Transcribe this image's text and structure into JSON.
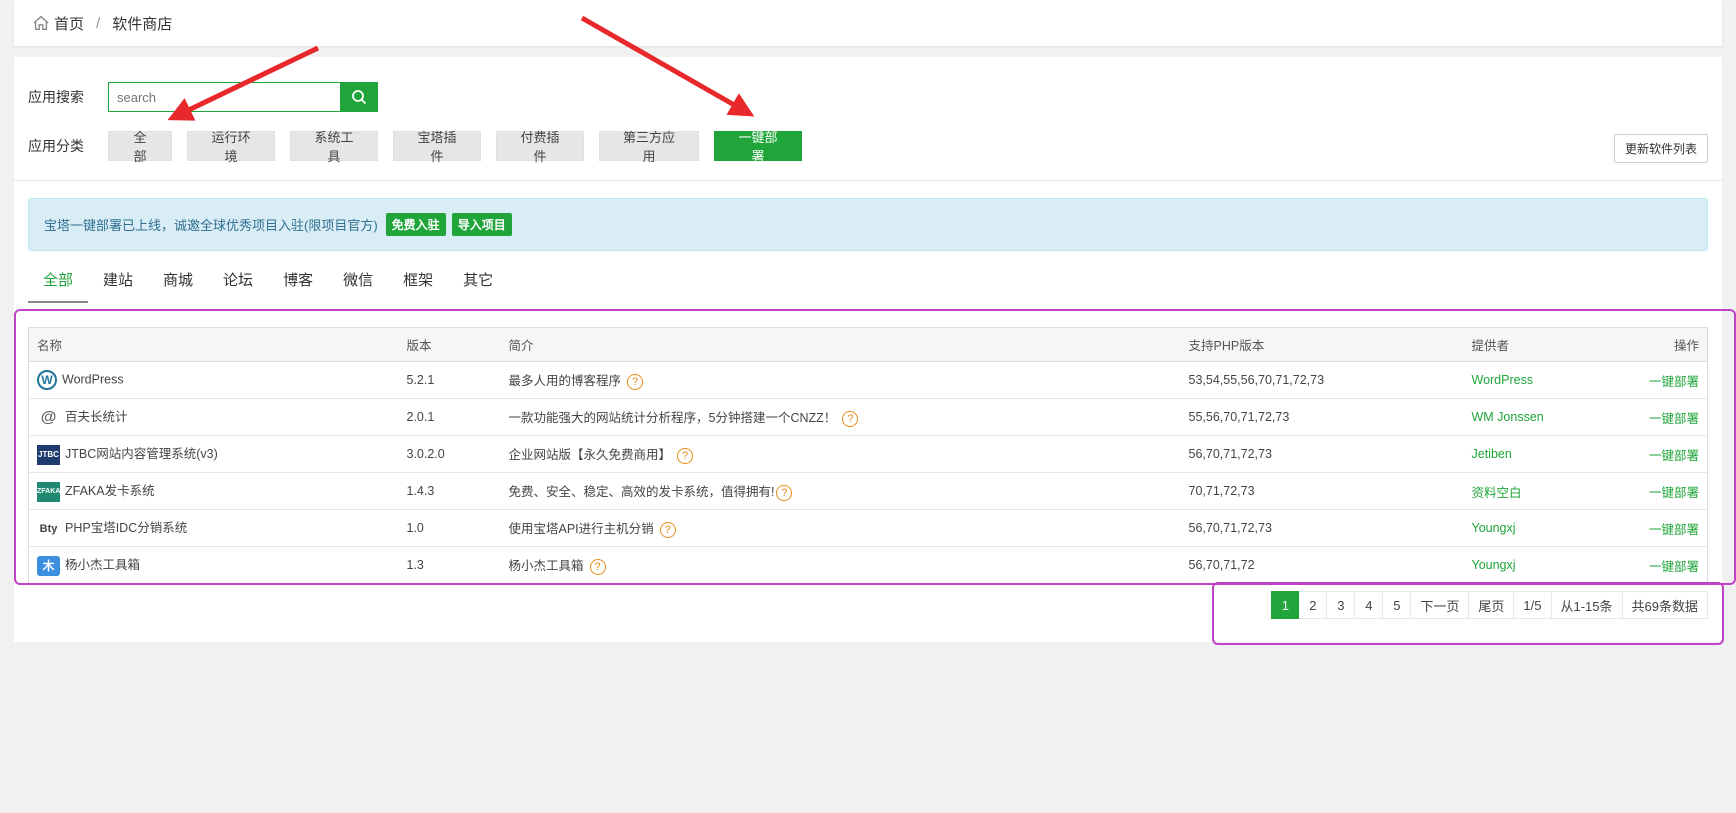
{
  "breadcrumb": {
    "home": "首页",
    "separator": "/",
    "current": "软件商店"
  },
  "search": {
    "label": "应用搜索",
    "placeholder": "search"
  },
  "category": {
    "label": "应用分类",
    "buttons": [
      "全部",
      "运行环境",
      "系统工具",
      "宝塔插件",
      "付费插件",
      "第三方应用",
      "一键部署"
    ],
    "active_index": 6
  },
  "refresh_button": "更新软件列表",
  "notice": {
    "text": "宝塔一键部署已上线，诚邀全球优秀项目入驻(限项目官方)",
    "btn_join": "免费入驻",
    "btn_import": "导入项目"
  },
  "tabs": [
    "全部",
    "建站",
    "商城",
    "论坛",
    "博客",
    "微信",
    "框架",
    "其它"
  ],
  "table": {
    "headers": {
      "name": "名称",
      "version": "版本",
      "desc": "简介",
      "php": "支持PHP版本",
      "provider": "提供者",
      "op": "操作"
    },
    "rows": [
      {
        "icon": "wordpress-icon",
        "icon_text": "W",
        "name": "WordPress",
        "version": "5.2.1",
        "desc": "最多人用的博客程序",
        "php": "53,54,55,56,70,71,72,73",
        "provider": "WordPress",
        "op": "一键部署"
      },
      {
        "icon": "baifu-icon",
        "icon_text": "@",
        "name": "百夫长统计",
        "version": "2.0.1",
        "desc": "一款功能强大的网站统计分析程序，5分钟搭建一个CNZZ！",
        "php": "55,56,70,71,72,73",
        "provider": "WM Jonssen",
        "op": "一键部署"
      },
      {
        "icon": "jtbc-icon",
        "icon_text": "JTBC",
        "name": "JTBC网站内容管理系统(v3)",
        "version": "3.0.2.0",
        "desc": "企业网站版【永久免费商用】",
        "php": "56,70,71,72,73",
        "provider": "Jetiben",
        "op": "一键部署"
      },
      {
        "icon": "zfaka-icon",
        "icon_text": "ZFAKA",
        "name": "ZFAKA发卡系统",
        "version": "1.4.3",
        "desc": "免费、安全、稳定、高效的发卡系统，值得拥有!",
        "php": "70,71,72,73",
        "provider": "资料空白",
        "op": "一键部署"
      },
      {
        "icon": "bty-icon",
        "icon_text": "Bty",
        "name": "PHP宝塔IDC分销系统",
        "version": "1.0",
        "desc": "使用宝塔API进行主机分销",
        "php": "56,70,71,72,73",
        "provider": "Youngxj",
        "op": "一键部署"
      },
      {
        "icon": "yang-icon",
        "icon_text": "木",
        "name": "杨小杰工具箱",
        "version": "1.3",
        "desc": "杨小杰工具箱",
        "php": "56,70,71,72",
        "provider": "Youngxj",
        "op": "一键部署"
      }
    ]
  },
  "pager": [
    "1",
    "2",
    "3",
    "4",
    "5",
    "下一页",
    "尾页",
    "1/5",
    "从1-15条",
    "共69条数据"
  ],
  "colors": {
    "accent": "#20a53a",
    "annotation_arrow": "#e8282b",
    "highlight_box": "#c142c7"
  }
}
